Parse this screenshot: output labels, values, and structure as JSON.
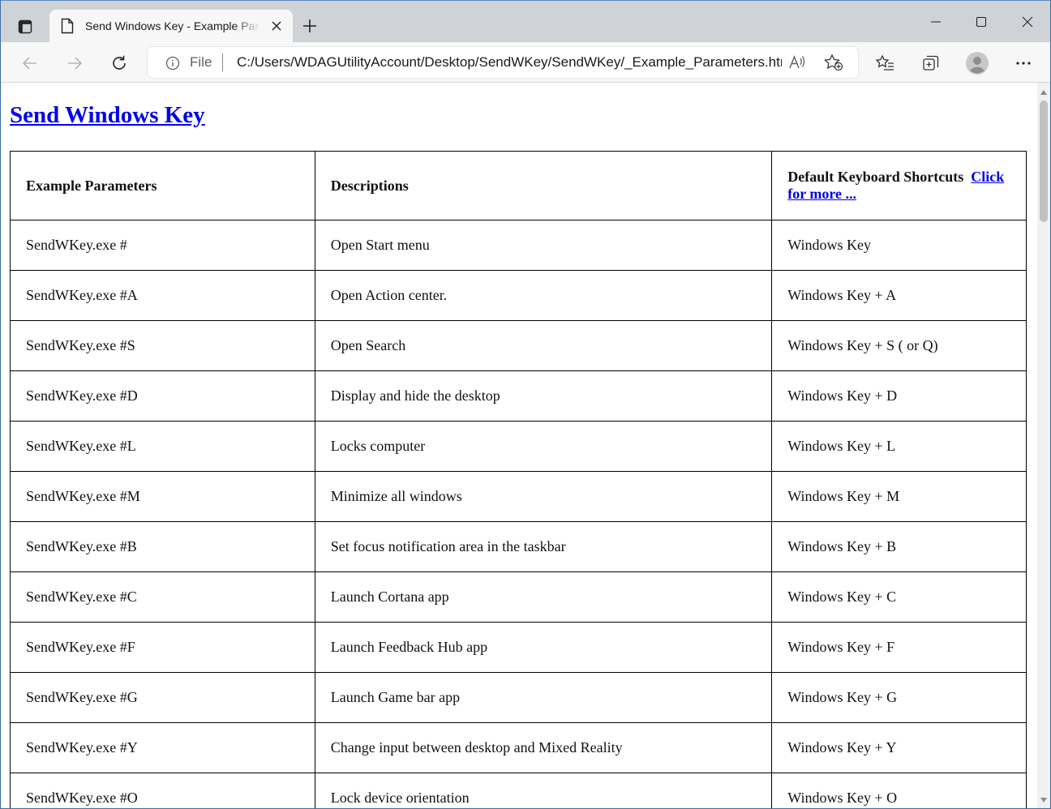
{
  "browser": {
    "tab_title": "Send Windows Key - Example Parameters",
    "address": {
      "scheme_label": "File",
      "url": "C:/Users/WDAGUtilityAccount/Desktop/SendWKey/SendWKey/_Example_Parameters.html"
    },
    "icons": {
      "tab_actions": "tab-actions-icon",
      "page": "page-icon",
      "close": "close-icon",
      "new_tab": "plus-icon",
      "minimize": "minimize-icon",
      "maximize": "maximize-icon",
      "close_window": "close-window-icon",
      "back": "back-arrow-icon",
      "forward": "forward-arrow-icon",
      "refresh": "refresh-icon",
      "info": "info-icon",
      "read_aloud": "read-aloud-icon",
      "add_favorite": "add-favorite-icon",
      "favorites": "favorites-icon",
      "collections": "collections-icon",
      "profile": "profile-avatar",
      "more": "more-icon"
    }
  },
  "page": {
    "heading": "Send Windows Key",
    "table": {
      "headers": {
        "col1": "Example Parameters",
        "col2": "Descriptions",
        "col3_text": "Default Keyboard Shortcuts",
        "col3_link": "Click for more ..."
      },
      "rows": [
        {
          "param": "SendWKey.exe #",
          "desc": "Open Start menu",
          "shortcut": "Windows Key"
        },
        {
          "param": "SendWKey.exe #A",
          "desc": "Open Action center.",
          "shortcut": "Windows Key + A"
        },
        {
          "param": "SendWKey.exe #S",
          "desc": "Open Search",
          "shortcut": "Windows Key + S ( or Q)"
        },
        {
          "param": "SendWKey.exe #D",
          "desc": "Display and hide the desktop",
          "shortcut": "Windows Key + D"
        },
        {
          "param": "SendWKey.exe #L",
          "desc": "Locks computer",
          "shortcut": "Windows Key + L"
        },
        {
          "param": "SendWKey.exe #M",
          "desc": "Minimize all windows",
          "shortcut": "Windows Key + M"
        },
        {
          "param": "SendWKey.exe #B",
          "desc": "Set focus notification area in the taskbar",
          "shortcut": "Windows Key + B"
        },
        {
          "param": "SendWKey.exe #C",
          "desc": "Launch Cortana app",
          "shortcut": "Windows Key + C"
        },
        {
          "param": "SendWKey.exe #F",
          "desc": "Launch Feedback Hub app",
          "shortcut": "Windows Key + F"
        },
        {
          "param": "SendWKey.exe #G",
          "desc": "Launch Game bar app",
          "shortcut": "Windows Key + G"
        },
        {
          "param": "SendWKey.exe #Y",
          "desc": "Change input between desktop and Mixed Reality",
          "shortcut": "Windows Key + Y"
        },
        {
          "param": "SendWKey.exe #O",
          "desc": "Lock device orientation",
          "shortcut": "Windows Key + O"
        }
      ]
    }
  },
  "colors": {
    "link": "#0000ee",
    "tabstrip": "#cfd3d8",
    "toolbar": "#f7f7f7"
  }
}
